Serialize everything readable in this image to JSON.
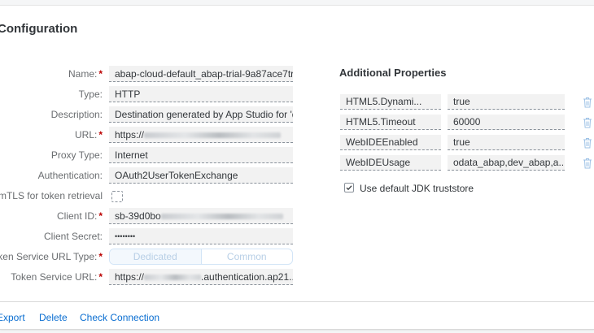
{
  "page": {
    "title": "Configuration"
  },
  "form": {
    "name": {
      "label": "Name:",
      "value": "abap-cloud-default_abap-trial-9a87ace7tri..."
    },
    "type": {
      "label": "Type:",
      "value": "HTTP"
    },
    "description": {
      "label": "Description:",
      "value": "Destination generated by App Studio for 'd..."
    },
    "url": {
      "label": "URL:",
      "value_prefix": "https://",
      "value_suffix": ""
    },
    "proxy_type": {
      "label": "Proxy Type:",
      "value": "Internet"
    },
    "authentication": {
      "label": "Authentication:",
      "value": "OAuth2UserTokenExchange"
    },
    "mtls": {
      "label": "Use mTLS for token retrieval"
    },
    "client_id": {
      "label": "Client ID:",
      "value_prefix": "sb-39d0bo"
    },
    "client_secret": {
      "label": "Client Secret:",
      "value": "••••••••"
    },
    "token_service_url_type": {
      "label": "Token Service URL Type:",
      "options": [
        "Dedicated",
        "Common"
      ]
    },
    "token_service_url": {
      "label": "Token Service URL:",
      "value_prefix": "https://",
      "value_suffix": ".authentication.ap21...."
    }
  },
  "additional_properties": {
    "title": "Additional Properties",
    "rows": [
      {
        "key": "HTML5.Dynami...",
        "value": "true"
      },
      {
        "key": "HTML5.Timeout",
        "value": "60000"
      },
      {
        "key": "WebIDEEnabled",
        "value": "true"
      },
      {
        "key": "WebIDEUsage",
        "value": "odata_abap,dev_abap,a..."
      }
    ],
    "truststore_label": "Use default JDK truststore"
  },
  "footer": {
    "export": "Export",
    "delete": "Delete",
    "check_connection": "Check Connection"
  },
  "colors": {
    "accent": "#0a6ed1",
    "required": "#bb0000",
    "field_bg": "#f2f2f2",
    "trash": "#9ec2e6"
  }
}
